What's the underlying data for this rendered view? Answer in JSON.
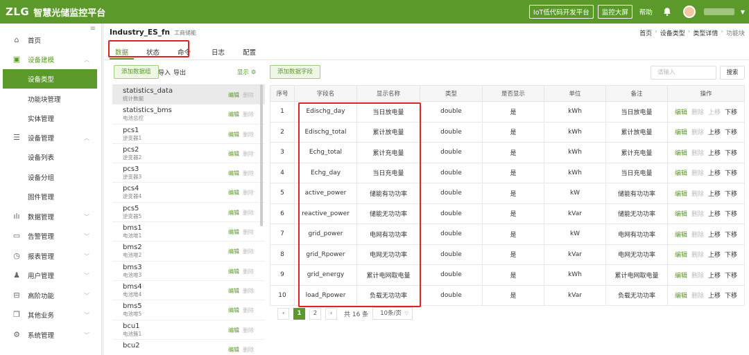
{
  "topbar": {
    "logo": "ZLG",
    "title": "智慧光储监控平台",
    "iot_btn": "IoT低代码开发平台",
    "screen_btn": "监控大屏",
    "help": "帮助"
  },
  "sidebar": {
    "home": "首页",
    "device_model": "设备建模",
    "device_type": "设备类型",
    "function_block": "功能块管理",
    "entity": "实体管理",
    "device_mgmt": "设备管理",
    "device_list": "设备列表",
    "device_group": "设备分组",
    "firmware": "固件管理",
    "data_mgmt": "数据管理",
    "alarm_mgmt": "告警管理",
    "report_mgmt": "报表管理",
    "user_mgmt": "用户管理",
    "advanced": "高阶功能",
    "other": "其他业务",
    "system": "系统管理"
  },
  "header": {
    "title": "Industry_ES_fn",
    "subtitle": "工商储能",
    "breadcrumb": [
      "首页",
      "设备类型",
      "类型详情",
      "功能块"
    ]
  },
  "tabs": [
    "数据",
    "状态",
    "命令",
    "日志",
    "配置"
  ],
  "toolbar": {
    "add_group": "添加数据组",
    "import": "导入",
    "export": "导出",
    "show": "显示",
    "add_field": "添加数据字段",
    "search_placeholder": "请输入",
    "search": "搜索"
  },
  "groups": [
    {
      "name": "statistics_data",
      "desc": "统计数据"
    },
    {
      "name": "statistics_bms",
      "desc": "电池总控"
    },
    {
      "name": "pcs1",
      "desc": "逆变器1"
    },
    {
      "name": "pcs2",
      "desc": "逆变器2"
    },
    {
      "name": "pcs3",
      "desc": "逆变器3"
    },
    {
      "name": "pcs4",
      "desc": "逆变器4"
    },
    {
      "name": "pcs5",
      "desc": "逆变器5"
    },
    {
      "name": "bms1",
      "desc": "电池堆1"
    },
    {
      "name": "bms2",
      "desc": "电池堆2"
    },
    {
      "name": "bms3",
      "desc": "电池堆3"
    },
    {
      "name": "bms4",
      "desc": "电池堆4"
    },
    {
      "name": "bms5",
      "desc": "电池堆5"
    },
    {
      "name": "bcu1",
      "desc": "电池簇1"
    },
    {
      "name": "bcu2",
      "desc": ""
    }
  ],
  "group_actions": {
    "edit": "编辑",
    "delete": "删除"
  },
  "table": {
    "headers": [
      "序号",
      "字段名",
      "显示名称",
      "类型",
      "是否显示",
      "单位",
      "备注",
      "操作"
    ],
    "rows": [
      [
        "1",
        "Edischg_day",
        "当日放电量",
        "double",
        "是",
        "kWh",
        "当日放电量"
      ],
      [
        "2",
        "Edischg_total",
        "累计放电量",
        "double",
        "是",
        "kWh",
        "累计放电量"
      ],
      [
        "3",
        "Echg_total",
        "累计充电量",
        "double",
        "是",
        "kWh",
        "累计充电量"
      ],
      [
        "4",
        "Echg_day",
        "当日充电量",
        "double",
        "是",
        "kWh",
        "当日充电量"
      ],
      [
        "5",
        "active_power",
        "储能有功功率",
        "double",
        "是",
        "kW",
        "储能有功功率"
      ],
      [
        "6",
        "reactive_power",
        "储能无功功率",
        "double",
        "是",
        "kVar",
        "储能无功功率"
      ],
      [
        "7",
        "grid_power",
        "电网有功功率",
        "double",
        "是",
        "kW",
        "电网有功功率"
      ],
      [
        "8",
        "grid_Rpower",
        "电网无功功率",
        "double",
        "是",
        "kVar",
        "电网无功功率"
      ],
      [
        "9",
        "grid_energy",
        "累计电网取电量",
        "double",
        "是",
        "kWh",
        "累计电网取电量"
      ],
      [
        "10",
        "load_Rpower",
        "负载无功功率",
        "double",
        "是",
        "kVar",
        "负载无功功率"
      ]
    ],
    "ops": [
      "编辑",
      "删除",
      "上移",
      "下移"
    ]
  },
  "pager": {
    "prev": "‹",
    "pages": [
      "1",
      "2"
    ],
    "next": "›",
    "total": "共 16 条",
    "size": "10条/页"
  }
}
